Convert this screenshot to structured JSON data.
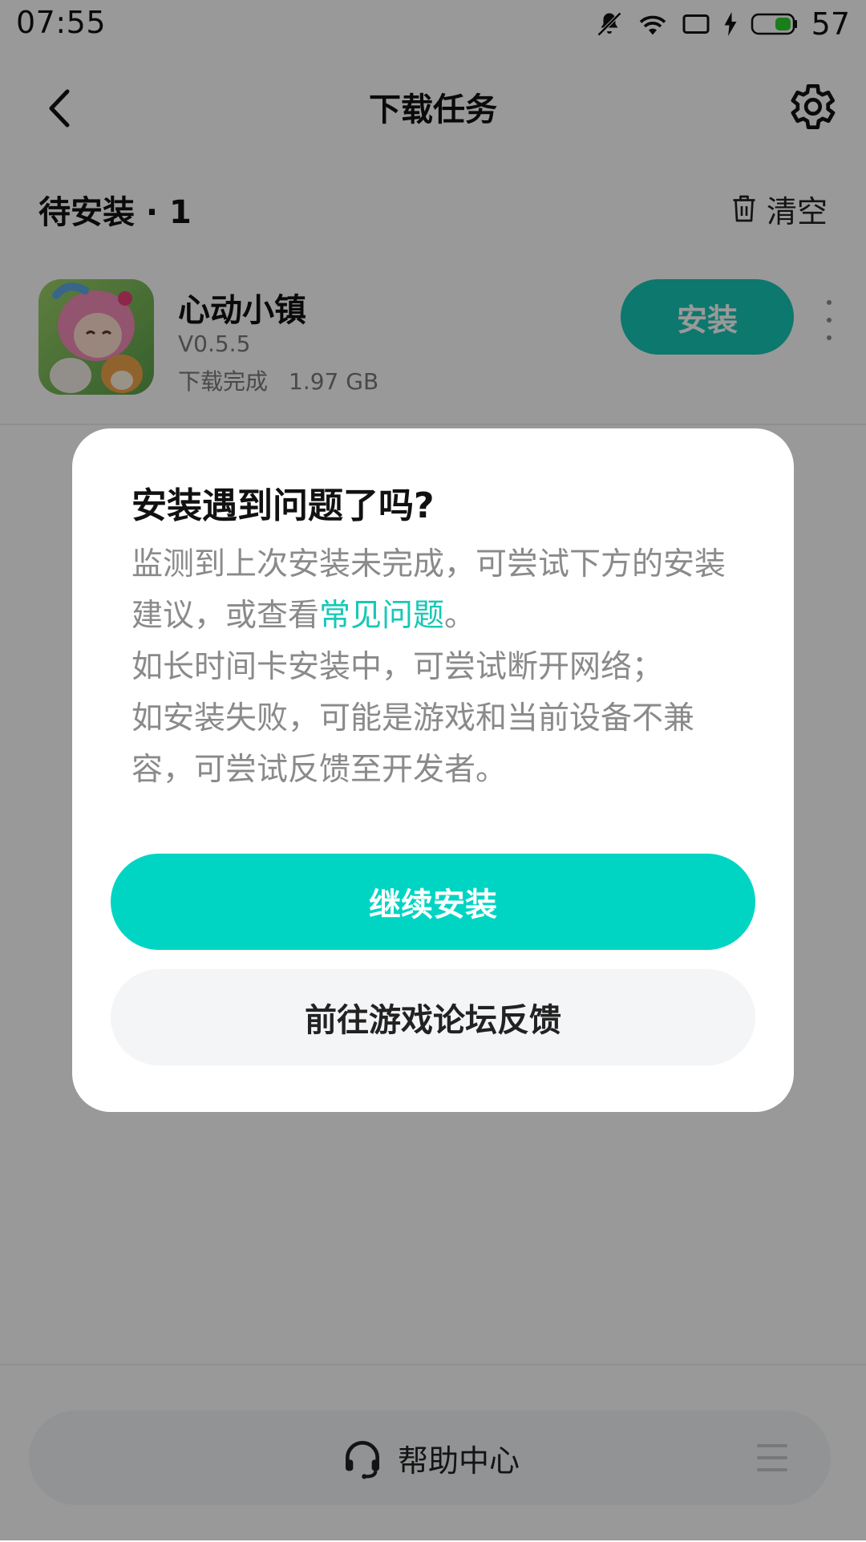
{
  "status_bar": {
    "time": "07:55",
    "battery": "57",
    "icons": [
      "mute-bell-icon",
      "wifi-icon",
      "screen-cast-icon",
      "charging-bolt-icon",
      "battery-icon"
    ]
  },
  "header": {
    "title": "下载任务",
    "back_icon": "chevron-left-icon",
    "settings_icon": "gear-icon"
  },
  "section": {
    "title": "待安装 · 1",
    "clear_label": "清空",
    "clear_icon": "trash-icon"
  },
  "items": [
    {
      "name": "心动小镇",
      "version": "V0.5.5",
      "status": "下载完成",
      "size": "1.97 GB",
      "action_label": "安装"
    }
  ],
  "bottom": {
    "help_label": "帮助中心",
    "help_icon": "headset-icon",
    "menu_icon": "menu-icon"
  },
  "dialog": {
    "title": "安装遇到问题了吗?",
    "line1_prefix": "监测到上次安装未完成，可尝试下方的安装建议，或查看",
    "faq_link": "常见问题",
    "line1_suffix": "。",
    "line2": "如长时间卡安装中，可尝试断开网络；",
    "line3": "如安装失败，可能是游戏和当前设备不兼容，可尝试反馈至开发者。",
    "primary_button": "继续安装",
    "secondary_button": "前往游戏论坛反馈"
  },
  "colors": {
    "accent": "#00d5c3",
    "install_button": "#17c8b6",
    "overlay": "rgba(0,0,0,0.40)"
  }
}
